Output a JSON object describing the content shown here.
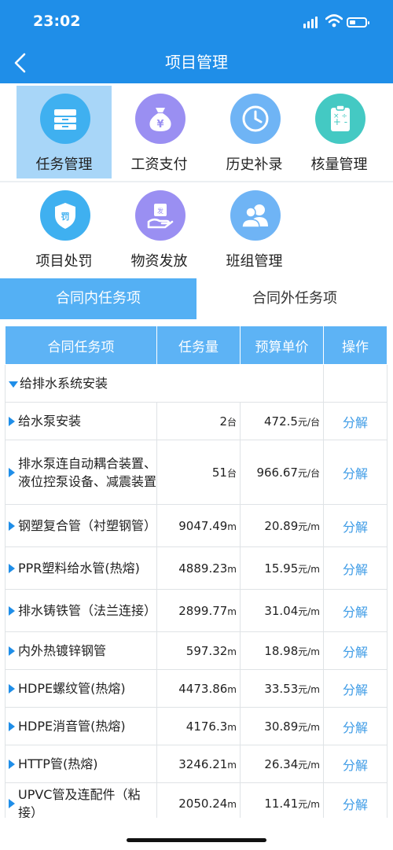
{
  "status": {
    "time": "23:02"
  },
  "header": {
    "title": "项目管理"
  },
  "grid": [
    {
      "label": "任务管理",
      "icon": "drawer-icon",
      "color": "#3fb0f0",
      "selected": true
    },
    {
      "label": "工资支付",
      "icon": "money-bag-icon",
      "color": "#9a8ff2"
    },
    {
      "label": "历史补录",
      "icon": "clock-icon",
      "color": "#6fb4f5"
    },
    {
      "label": "核量管理",
      "icon": "calculator-clipboard-icon",
      "color": "#44c9c3"
    },
    {
      "label": "项目处罚",
      "icon": "penalty-shield-icon",
      "color": "#3fb0f0"
    },
    {
      "label": "物资发放",
      "icon": "material-hand-icon",
      "color": "#9a8ff2"
    },
    {
      "label": "班组管理",
      "icon": "team-icon",
      "color": "#6fb4f5"
    }
  ],
  "tabs": {
    "active": "合同内任务项",
    "inactive": "合同外任务项"
  },
  "table": {
    "headers": [
      "合同任务项",
      "任务量",
      "预算单价",
      "操作"
    ],
    "group": "给排水系统安装",
    "rows": [
      {
        "name": "给水泵安装",
        "qty": "2",
        "qty_unit": "台",
        "price": "472.5",
        "price_unit": "元/台",
        "op": "分解"
      },
      {
        "name": "排水泵连自动耦合装置、液位控泵设备、减震装置",
        "qty": "51",
        "qty_unit": "台",
        "price": "966.67",
        "price_unit": "元/台",
        "op": "分解"
      },
      {
        "name": "钢塑复合管（衬塑钢管）",
        "qty": "9047.49",
        "qty_unit": "m",
        "price": "20.89",
        "price_unit": "元/m",
        "op": "分解"
      },
      {
        "name": "PPR塑料给水管(热熔)",
        "qty": "4889.23",
        "qty_unit": "m",
        "price": "15.95",
        "price_unit": "元/m",
        "op": "分解"
      },
      {
        "name": "排水铸铁管（法兰连接）",
        "qty": "2899.77",
        "qty_unit": "m",
        "price": "31.04",
        "price_unit": "元/m",
        "op": "分解"
      },
      {
        "name": "内外热镀锌钢管",
        "qty": "597.32",
        "qty_unit": "m",
        "price": "18.98",
        "price_unit": "元/m",
        "op": "分解"
      },
      {
        "name": "HDPE螺纹管(热熔)",
        "qty": "4473.86",
        "qty_unit": "m",
        "price": "33.53",
        "price_unit": "元/m",
        "op": "分解"
      },
      {
        "name": "HDPE消音管(热熔)",
        "qty": "4176.3",
        "qty_unit": "m",
        "price": "30.89",
        "price_unit": "元/m",
        "op": "分解"
      },
      {
        "name": "HTTP管(热熔)",
        "qty": "3246.21",
        "qty_unit": "m",
        "price": "26.34",
        "price_unit": "元/m",
        "op": "分解"
      },
      {
        "name": "UPVC管及连配件（粘接）",
        "qty": "2050.24",
        "qty_unit": "m",
        "price": "11.41",
        "price_unit": "元/m",
        "op": "分解"
      }
    ]
  }
}
